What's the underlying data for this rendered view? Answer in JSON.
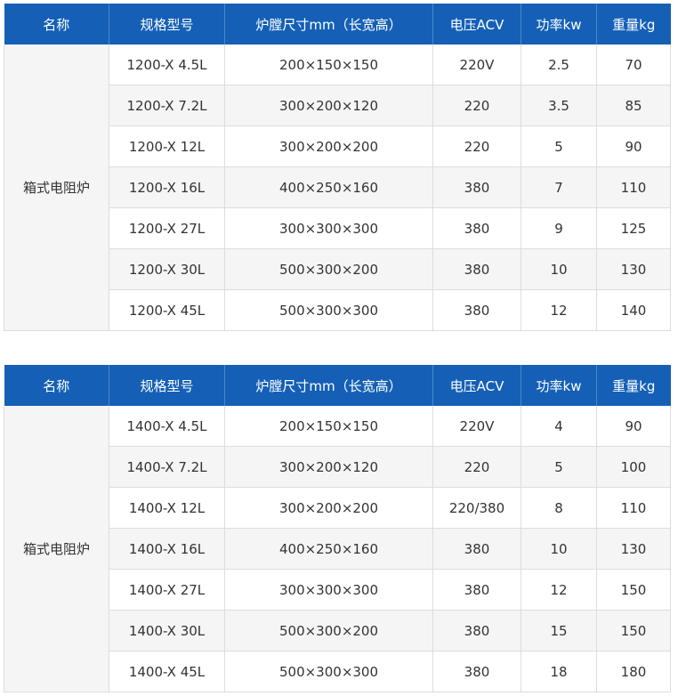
{
  "headers": [
    "名称",
    "规格型号",
    "炉膛尺寸mm（长宽高）",
    "电压ACV",
    "功率kw",
    "重量kg"
  ],
  "tables": [
    {
      "name": "箱式电阻炉",
      "rows": [
        {
          "model": "1200-X 4.5L",
          "size": "200×150×150",
          "voltage": "220V",
          "power": "2.5",
          "weight": "70"
        },
        {
          "model": "1200-X 7.2L",
          "size": "300×200×120",
          "voltage": "220",
          "power": "3.5",
          "weight": "85"
        },
        {
          "model": "1200-X 12L",
          "size": "300×200×200",
          "voltage": "220",
          "power": "5",
          "weight": "90"
        },
        {
          "model": "1200-X 16L",
          "size": "400×250×160",
          "voltage": "380",
          "power": "7",
          "weight": "110"
        },
        {
          "model": "1200-X 27L",
          "size": "300×300×300",
          "voltage": "380",
          "power": "9",
          "weight": "125"
        },
        {
          "model": "1200-X 30L",
          "size": "500×300×200",
          "voltage": "380",
          "power": "10",
          "weight": "130"
        },
        {
          "model": "1200-X 45L",
          "size": "500×300×300",
          "voltage": "380",
          "power": "12",
          "weight": "140"
        }
      ]
    },
    {
      "name": "箱式电阻炉",
      "rows": [
        {
          "model": "1400-X 4.5L",
          "size": "200×150×150",
          "voltage": "220V",
          "power": "4",
          "weight": "90"
        },
        {
          "model": "1400-X 7.2L",
          "size": "300×200×120",
          "voltage": "220",
          "power": "5",
          "weight": "100"
        },
        {
          "model": "1400-X 12L",
          "size": "300×200×200",
          "voltage": "220/380",
          "power": "8",
          "weight": "110"
        },
        {
          "model": "1400-X 16L",
          "size": "400×250×160",
          "voltage": "380",
          "power": "10",
          "weight": "130"
        },
        {
          "model": "1400-X 27L",
          "size": "300×300×300",
          "voltage": "380",
          "power": "12",
          "weight": "150"
        },
        {
          "model": "1400-X 30L",
          "size": "500×300×200",
          "voltage": "380",
          "power": "15",
          "weight": "150"
        },
        {
          "model": "1400-X 45L",
          "size": "500×300×300",
          "voltage": "380",
          "power": "18",
          "weight": "180"
        }
      ]
    }
  ]
}
